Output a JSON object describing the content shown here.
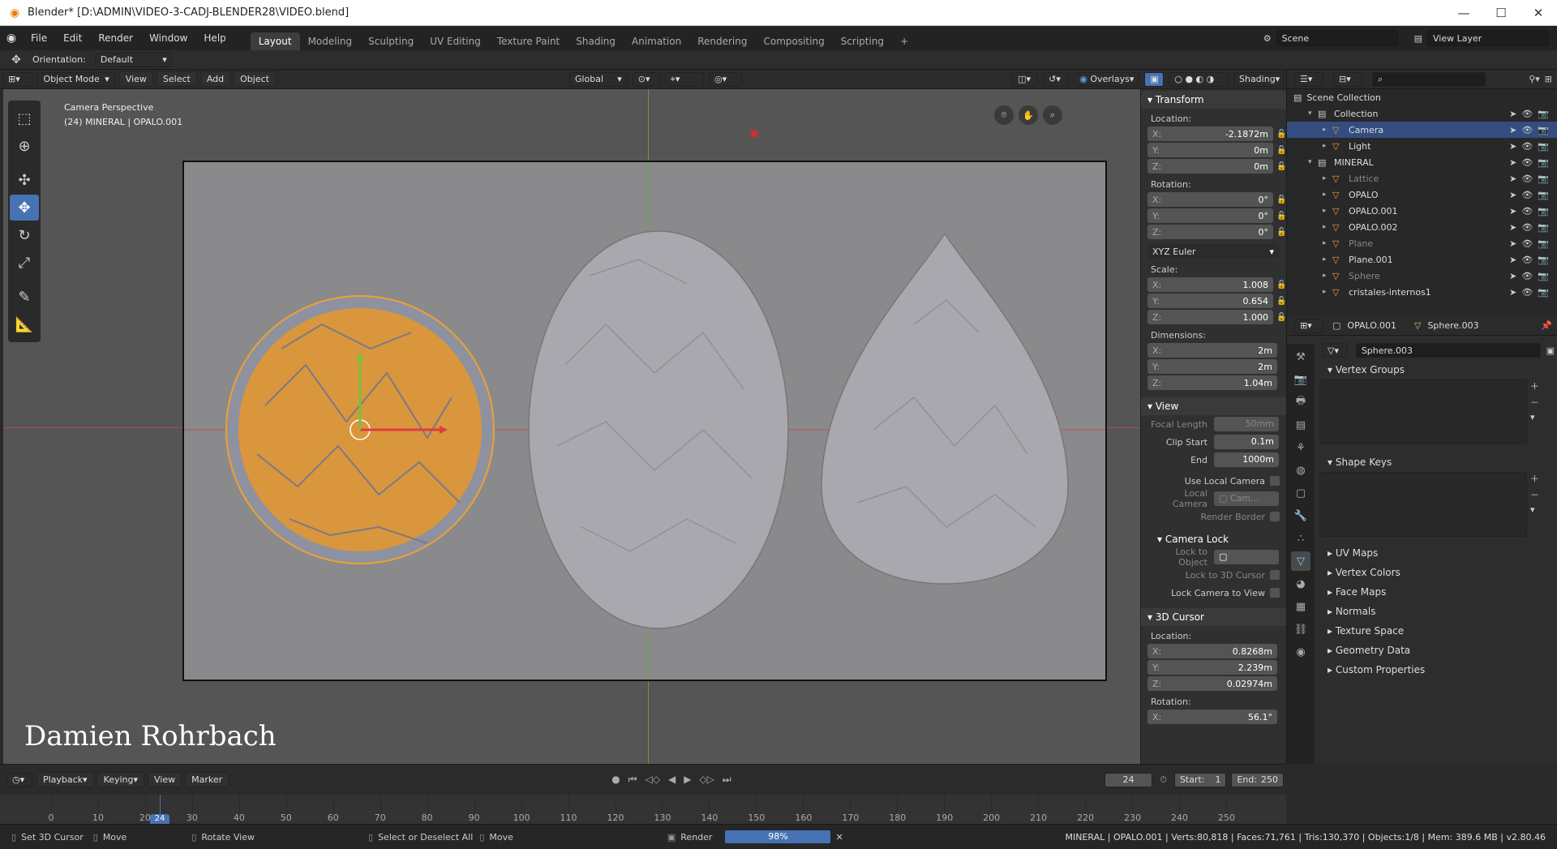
{
  "window": {
    "title": "Blender* [D:\\ADMIN\\VIDEO-3-CADJ-BLENDER28\\VIDEO.blend]"
  },
  "menu": [
    "File",
    "Edit",
    "Render",
    "Window",
    "Help"
  ],
  "workspaces": [
    "Layout",
    "Modeling",
    "Sculpting",
    "UV Editing",
    "Texture Paint",
    "Shading",
    "Animation",
    "Rendering",
    "Compositing",
    "Scripting"
  ],
  "scene": {
    "name": "Scene",
    "view_layer": "View Layer"
  },
  "tool_header": {
    "orientation_label": "Orientation:",
    "orientation_value": "Default"
  },
  "viewport_header": {
    "mode": "Object Mode",
    "menus": [
      "View",
      "Select",
      "Add",
      "Object"
    ],
    "transform_orientation": "Global",
    "overlays": "Overlays",
    "shading": "Shading"
  },
  "viewport": {
    "view_name": "Camera Perspective",
    "object_info": "(24) MINERAL | OPALO.001",
    "watermark": "Damien Rohrbach"
  },
  "npanel": {
    "transform": {
      "title": "Transform",
      "location_label": "Location:",
      "location": [
        {
          "axis": "X:",
          "value": "-2.1872m"
        },
        {
          "axis": "Y:",
          "value": "0m"
        },
        {
          "axis": "Z:",
          "value": "0m"
        }
      ],
      "rotation_label": "Rotation:",
      "rotation": [
        {
          "axis": "X:",
          "value": "0°"
        },
        {
          "axis": "Y:",
          "value": "0°"
        },
        {
          "axis": "Z:",
          "value": "0°"
        }
      ],
      "rotation_mode": "XYZ Euler",
      "scale_label": "Scale:",
      "scale": [
        {
          "axis": "X:",
          "value": "1.008"
        },
        {
          "axis": "Y:",
          "value": "0.654"
        },
        {
          "axis": "Z:",
          "value": "1.000"
        }
      ],
      "dimensions_label": "Dimensions:",
      "dimensions": [
        {
          "axis": "X:",
          "value": "2m"
        },
        {
          "axis": "Y:",
          "value": "2m"
        },
        {
          "axis": "Z:",
          "value": "1.04m"
        }
      ]
    },
    "view": {
      "title": "View",
      "focal_length_label": "Focal Length",
      "focal_length": "50mm",
      "clip_start_label": "Clip Start",
      "clip_start": "0.1m",
      "clip_end_label": "End",
      "clip_end": "1000m",
      "use_local_camera": "Use Local Camera",
      "local_camera_label": "Local Camera",
      "local_camera_value": "Cam...",
      "render_border": "Render Border",
      "camera_lock": "Camera Lock",
      "lock_to_object": "Lock to Object",
      "lock_to_3d_cursor": "Lock to 3D Cursor",
      "lock_camera_to_view": "Lock Camera to View"
    },
    "cursor": {
      "title": "3D Cursor",
      "location_label": "Location:",
      "location": [
        {
          "axis": "X:",
          "value": "0.8268m"
        },
        {
          "axis": "Y:",
          "value": "2.239m"
        },
        {
          "axis": "Z:",
          "value": "0.02974m"
        }
      ],
      "rotation_label": "Rotation:",
      "rotation_x": {
        "axis": "X:",
        "value": "56.1°"
      }
    }
  },
  "outliner": {
    "root": "Scene Collection",
    "rows": [
      {
        "name": "Collection",
        "indent": 1,
        "selected": false,
        "dim": false
      },
      {
        "name": "Camera",
        "indent": 2,
        "selected": true,
        "dim": false
      },
      {
        "name": "Light",
        "indent": 2,
        "selected": false,
        "dim": false
      },
      {
        "name": "MINERAL",
        "indent": 1,
        "selected": false,
        "dim": false
      },
      {
        "name": "Lattice",
        "indent": 2,
        "selected": false,
        "dim": true
      },
      {
        "name": "OPALO",
        "indent": 2,
        "selected": false,
        "dim": false
      },
      {
        "name": "OPALO.001",
        "indent": 2,
        "selected": false,
        "dim": false
      },
      {
        "name": "OPALO.002",
        "indent": 2,
        "selected": false,
        "dim": false
      },
      {
        "name": "Plane",
        "indent": 2,
        "selected": false,
        "dim": true
      },
      {
        "name": "Plane.001",
        "indent": 2,
        "selected": false,
        "dim": false
      },
      {
        "name": "Sphere",
        "indent": 2,
        "selected": false,
        "dim": true
      },
      {
        "name": "cristales-internos1",
        "indent": 2,
        "selected": false,
        "dim": false
      }
    ]
  },
  "properties": {
    "object": "OPALO.001",
    "mesh": "Sphere.003",
    "mesh_field": "Sphere.003",
    "vertex_groups": "Vertex Groups",
    "shape_keys": "Shape Keys",
    "sections": [
      "UV Maps",
      "Vertex Colors",
      "Face Maps",
      "Normals",
      "Texture Space",
      "Geometry Data",
      "Custom Properties"
    ]
  },
  "timeline": {
    "menus": [
      "Playback",
      "Keying",
      "View",
      "Marker"
    ],
    "current_frame": "24",
    "start_label": "Start:",
    "start": "1",
    "end_label": "End:",
    "end": "250",
    "ticks": [
      "0",
      "10",
      "20",
      "30",
      "40",
      "50",
      "60",
      "70",
      "80",
      "90",
      "100",
      "110",
      "120",
      "130",
      "140",
      "150",
      "160",
      "170",
      "180",
      "190",
      "200",
      "210",
      "220",
      "230",
      "240",
      "250"
    ],
    "playhead": "24"
  },
  "statusbar": {
    "hints": [
      "Set 3D Cursor",
      "Move",
      "Rotate View",
      "Select or Deselect All",
      "Move"
    ],
    "render_label": "Render",
    "render_progress": "98%",
    "stats": "MINERAL | OPALO.001 | Verts:80,818 | Faces:71,761 | Tris:130,370 | Objects:1/8 | Mem: 389.6 MB | v2.80.46"
  }
}
